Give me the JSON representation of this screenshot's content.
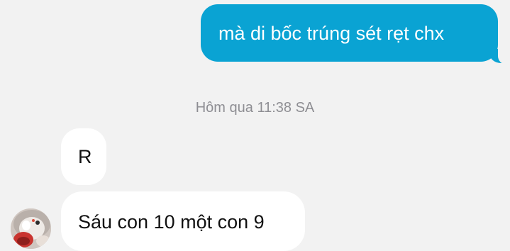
{
  "conversation": {
    "messages": [
      {
        "direction": "outgoing",
        "text": "mà di bốc trúng sét rẹt chx"
      },
      {
        "direction": "incoming",
        "text": "R"
      },
      {
        "direction": "incoming",
        "text": "Sáu con 10 một con 9"
      }
    ],
    "timestamp": "Hôm qua 11:38 SA"
  },
  "colors": {
    "background": "#f2f2f2",
    "outgoing_bubble": "#0aa3d3",
    "incoming_bubble": "#ffffff",
    "timestamp_text": "#8e8e93"
  },
  "icons": {
    "avatar": "user-avatar-photo"
  }
}
